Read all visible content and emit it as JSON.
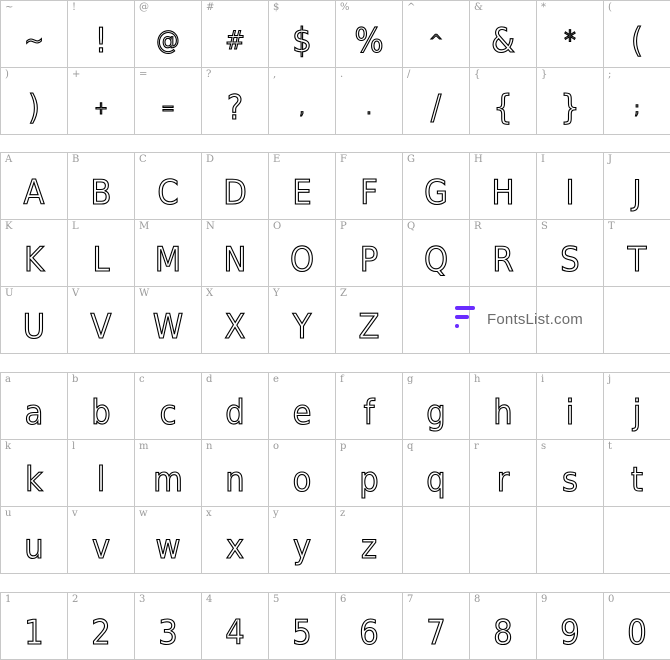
{
  "brand": {
    "text": "FontsList.com",
    "accent": "#6a2cff"
  },
  "sections": [
    {
      "name": "symbols",
      "rows": [
        [
          {
            "label": "~",
            "glyph": "~"
          },
          {
            "label": "!",
            "glyph": "!"
          },
          {
            "label": "@",
            "glyph": "@"
          },
          {
            "label": "#",
            "glyph": "#"
          },
          {
            "label": "$",
            "glyph": "$"
          },
          {
            "label": "%",
            "glyph": "%"
          },
          {
            "label": "^",
            "glyph": "^"
          },
          {
            "label": "&",
            "glyph": "&"
          },
          {
            "label": "*",
            "glyph": "*"
          },
          {
            "label": "(",
            "glyph": "("
          }
        ],
        [
          {
            "label": ")",
            "glyph": ")"
          },
          {
            "label": "+",
            "glyph": "+"
          },
          {
            "label": "=",
            "glyph": "="
          },
          {
            "label": "?",
            "glyph": "?"
          },
          {
            "label": ",",
            "glyph": ","
          },
          {
            "label": ".",
            "glyph": "."
          },
          {
            "label": "/",
            "glyph": "/"
          },
          {
            "label": "{",
            "glyph": "{"
          },
          {
            "label": "}",
            "glyph": "}"
          },
          {
            "label": ";",
            "glyph": ";"
          }
        ]
      ]
    },
    {
      "name": "uppercase",
      "rows": [
        [
          {
            "label": "A",
            "glyph": "A"
          },
          {
            "label": "B",
            "glyph": "B"
          },
          {
            "label": "C",
            "glyph": "C"
          },
          {
            "label": "D",
            "glyph": "D"
          },
          {
            "label": "E",
            "glyph": "E"
          },
          {
            "label": "F",
            "glyph": "F"
          },
          {
            "label": "G",
            "glyph": "G"
          },
          {
            "label": "H",
            "glyph": "H"
          },
          {
            "label": "I",
            "glyph": "I"
          },
          {
            "label": "J",
            "glyph": "J"
          }
        ],
        [
          {
            "label": "K",
            "glyph": "K"
          },
          {
            "label": "L",
            "glyph": "L"
          },
          {
            "label": "M",
            "glyph": "M"
          },
          {
            "label": "N",
            "glyph": "N"
          },
          {
            "label": "O",
            "glyph": "O"
          },
          {
            "label": "P",
            "glyph": "P"
          },
          {
            "label": "Q",
            "glyph": "Q"
          },
          {
            "label": "R",
            "glyph": "R"
          },
          {
            "label": "S",
            "glyph": "S"
          },
          {
            "label": "T",
            "glyph": "T"
          }
        ],
        [
          {
            "label": "U",
            "glyph": "U"
          },
          {
            "label": "V",
            "glyph": "V"
          },
          {
            "label": "W",
            "glyph": "W"
          },
          {
            "label": "X",
            "glyph": "X"
          },
          {
            "label": "Y",
            "glyph": "Y"
          },
          {
            "label": "Z",
            "glyph": "Z"
          },
          {
            "label": "",
            "glyph": ""
          },
          {
            "label": "",
            "glyph": ""
          },
          {
            "label": "",
            "glyph": ""
          },
          {
            "label": "",
            "glyph": ""
          }
        ]
      ]
    },
    {
      "name": "lowercase",
      "rows": [
        [
          {
            "label": "a",
            "glyph": "a"
          },
          {
            "label": "b",
            "glyph": "b"
          },
          {
            "label": "c",
            "glyph": "c"
          },
          {
            "label": "d",
            "glyph": "d"
          },
          {
            "label": "e",
            "glyph": "e"
          },
          {
            "label": "f",
            "glyph": "f"
          },
          {
            "label": "g",
            "glyph": "g"
          },
          {
            "label": "h",
            "glyph": "h"
          },
          {
            "label": "i",
            "glyph": "i"
          },
          {
            "label": "j",
            "glyph": "j"
          }
        ],
        [
          {
            "label": "k",
            "glyph": "k"
          },
          {
            "label": "l",
            "glyph": "l"
          },
          {
            "label": "m",
            "glyph": "m"
          },
          {
            "label": "n",
            "glyph": "n"
          },
          {
            "label": "o",
            "glyph": "o"
          },
          {
            "label": "p",
            "glyph": "p"
          },
          {
            "label": "q",
            "glyph": "q"
          },
          {
            "label": "r",
            "glyph": "r"
          },
          {
            "label": "s",
            "glyph": "s"
          },
          {
            "label": "t",
            "glyph": "t"
          }
        ],
        [
          {
            "label": "u",
            "glyph": "u"
          },
          {
            "label": "v",
            "glyph": "v"
          },
          {
            "label": "w",
            "glyph": "w"
          },
          {
            "label": "x",
            "glyph": "x"
          },
          {
            "label": "y",
            "glyph": "y"
          },
          {
            "label": "z",
            "glyph": "z"
          },
          {
            "label": "",
            "glyph": ""
          },
          {
            "label": "",
            "glyph": ""
          },
          {
            "label": "",
            "glyph": ""
          },
          {
            "label": "",
            "glyph": ""
          }
        ]
      ]
    },
    {
      "name": "digits",
      "rows": [
        [
          {
            "label": "1",
            "glyph": "1"
          },
          {
            "label": "2",
            "glyph": "2"
          },
          {
            "label": "3",
            "glyph": "3"
          },
          {
            "label": "4",
            "glyph": "4"
          },
          {
            "label": "5",
            "glyph": "5"
          },
          {
            "label": "6",
            "glyph": "6"
          },
          {
            "label": "7",
            "glyph": "7"
          },
          {
            "label": "8",
            "glyph": "8"
          },
          {
            "label": "9",
            "glyph": "9"
          },
          {
            "label": "0",
            "glyph": "0"
          }
        ]
      ]
    }
  ]
}
